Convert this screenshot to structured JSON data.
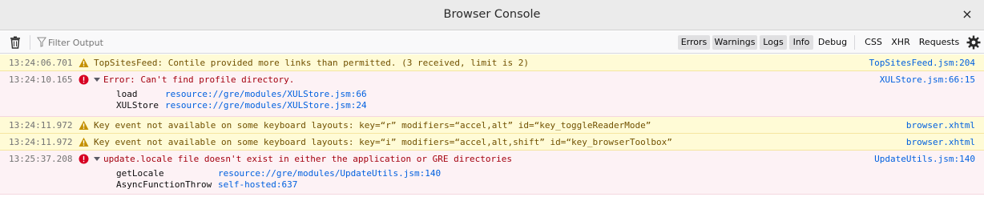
{
  "window": {
    "title": "Browser Console",
    "close": "×"
  },
  "toolbar": {
    "filter_placeholder": "Filter Output",
    "buttons": {
      "errors": "Errors",
      "warnings": "Warnings",
      "logs": "Logs",
      "info": "Info",
      "debug": "Debug",
      "css": "CSS",
      "xhr": "XHR",
      "requests": "Requests"
    }
  },
  "colors": {
    "warning_bg": "#fffbd6",
    "error_bg": "#fdf2f5",
    "link": "#0060df",
    "error_text": "#a4000f",
    "warning_text": "#715100"
  },
  "messages": [
    {
      "type": "warning",
      "time": "13:24:06.701",
      "icon": "warning-icon",
      "text": "TopSitesFeed: Contile provided more links than permitted. (3 received, limit is 2)",
      "location": "TopSitesFeed.jsm:204"
    },
    {
      "type": "error",
      "time": "13:24:10.165",
      "icon": "error-icon",
      "text": "Error: Can't find profile directory.",
      "location": "XULStore.jsm:66:15",
      "stack": [
        {
          "fn": "load",
          "loc": "resource://gre/modules/XULStore.jsm:66"
        },
        {
          "fn": "XULStore",
          "loc": "resource://gre/modules/XULStore.jsm:24"
        }
      ]
    },
    {
      "type": "warning",
      "time": "13:24:11.972",
      "icon": "warning-icon",
      "text": "Key event not available on some keyboard layouts: key=“r” modifiers=“accel,alt” id=“key_toggleReaderMode”",
      "location": "browser.xhtml"
    },
    {
      "type": "warning",
      "time": "13:24:11.972",
      "icon": "warning-icon",
      "text": "Key event not available on some keyboard layouts: key=“i” modifiers=“accel,alt,shift” id=“key_browserToolbox”",
      "location": "browser.xhtml"
    },
    {
      "type": "error",
      "time": "13:25:37.208",
      "icon": "error-icon",
      "text": "update.locale file doesn't exist in either the application or GRE directories",
      "location": "UpdateUtils.jsm:140",
      "stack": [
        {
          "fn": "getLocale",
          "loc": "resource://gre/modules/UpdateUtils.jsm:140"
        },
        {
          "fn": "AsyncFunctionThrow",
          "loc": "self-hosted:637"
        }
      ]
    }
  ]
}
